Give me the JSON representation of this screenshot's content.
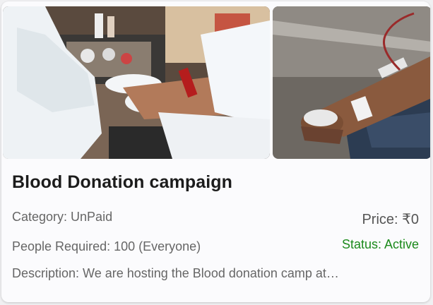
{
  "campaign": {
    "title": "Blood Donation campaign",
    "category": "Category: UnPaid",
    "people_required": "People Required: 100 (Everyone)",
    "price": "Price: ₹0",
    "status": "Status: Active",
    "description": "Description: We are hosting the Blood donation camp at…"
  },
  "images": [
    {
      "name": "blood-draw-photo"
    },
    {
      "name": "donor-arm-photo"
    }
  ],
  "colors": {
    "status_active": "#1b8a1b",
    "title": "#1c1c1c",
    "muted": "#666666"
  }
}
